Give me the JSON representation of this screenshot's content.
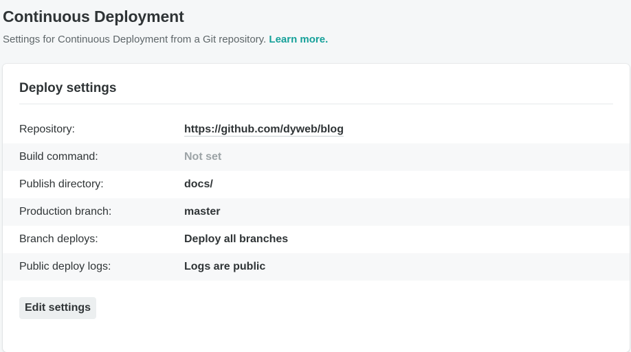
{
  "header": {
    "title": "Continuous Deployment",
    "description": "Settings for Continuous Deployment from a Git repository.",
    "learn_more": "Learn more."
  },
  "card": {
    "title": "Deploy settings",
    "rows": [
      {
        "label": "Repository:",
        "value": "https://github.com/dyweb/blog"
      },
      {
        "label": "Build command:",
        "value": "Not set"
      },
      {
        "label": "Publish directory:",
        "value": "docs/"
      },
      {
        "label": "Production branch:",
        "value": "master"
      },
      {
        "label": "Branch deploys:",
        "value": "Deploy all branches"
      },
      {
        "label": "Public deploy logs:",
        "value": "Logs are public"
      }
    ],
    "edit_button": "Edit settings"
  },
  "colors": {
    "accent": "#15a099",
    "text": "#2f3436",
    "muted": "#9ca3a6",
    "background": "#f5f7f8"
  }
}
